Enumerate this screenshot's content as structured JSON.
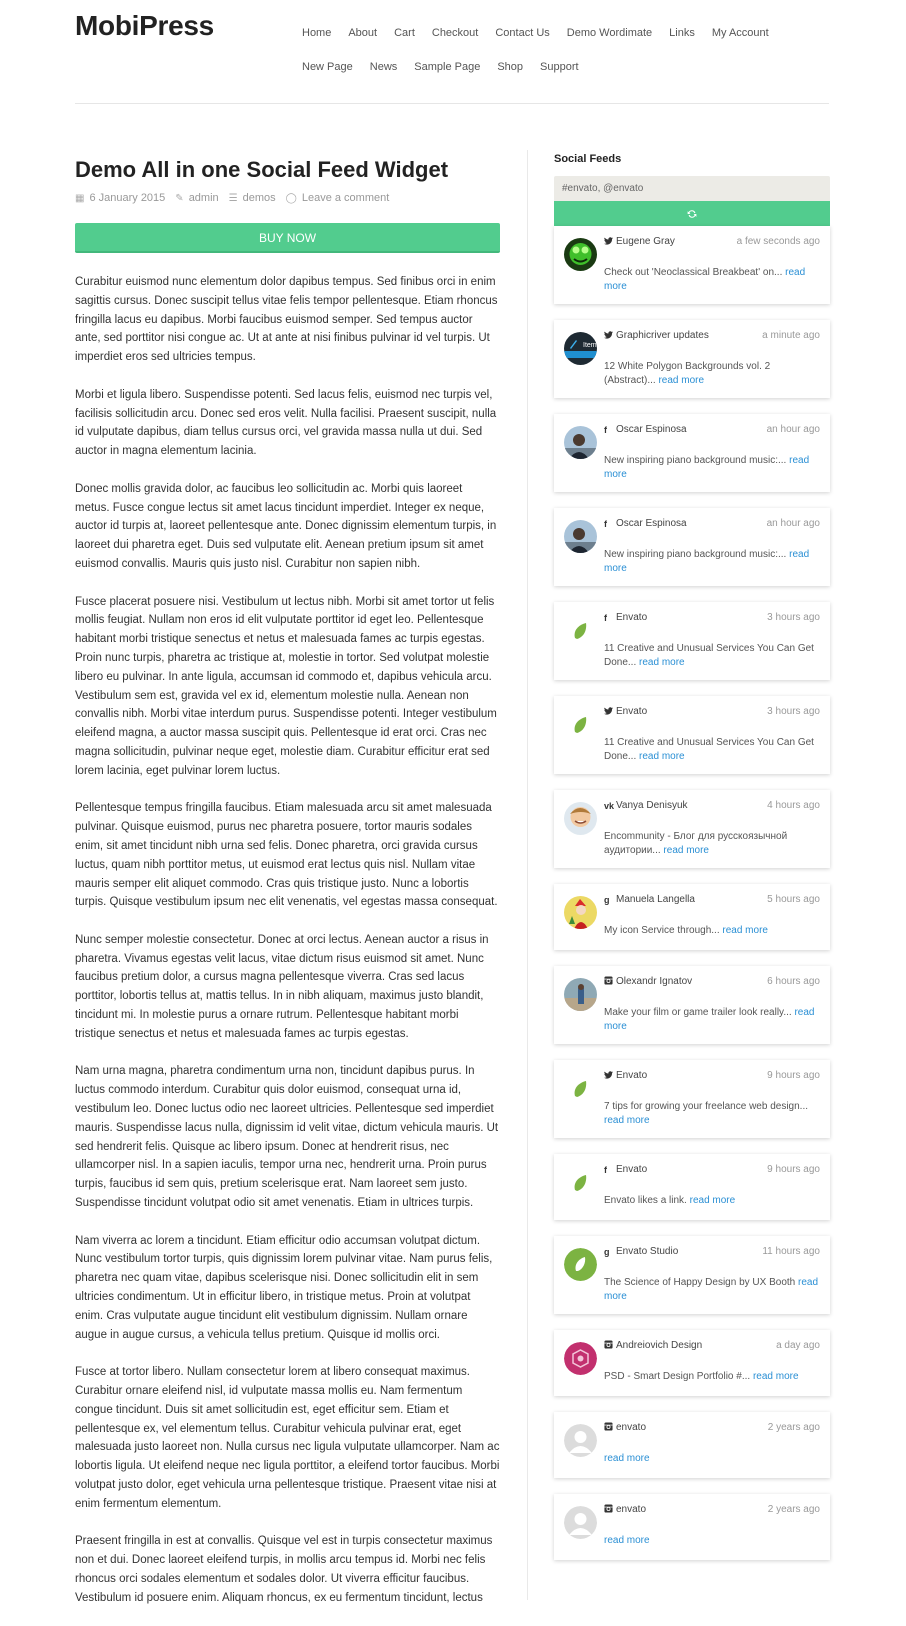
{
  "site": {
    "logo": "MobiPress",
    "nav": [
      "Home",
      "About",
      "Cart",
      "Checkout",
      "Contact Us",
      "Demo Wordimate",
      "Links",
      "My Account",
      "New Page",
      "News",
      "Sample Page",
      "Shop",
      "Support"
    ]
  },
  "post": {
    "title": "Demo All in one Social Feed Widget",
    "date": "6 January 2015",
    "author": "admin",
    "category": "demos",
    "comments": "Leave a comment",
    "buy_label": "BUY NOW",
    "paragraphs": [
      "Curabitur euismod nunc elementum dolor dapibus tempus. Sed finibus orci in enim sagittis cursus. Donec suscipit tellus vitae felis tempor pellentesque. Etiam rhoncus fringilla lacus eu dapibus. Morbi faucibus euismod semper. Sed tempus auctor ante, sed porttitor nisi congue ac. Ut at ante at nisi finibus pulvinar id vel turpis. Ut imperdiet eros sed ultricies tempus.",
      "Morbi et ligula libero. Suspendisse potenti. Sed lacus felis, euismod nec turpis vel, facilisis sollicitudin arcu. Donec sed eros velit. Nulla facilisi. Praesent suscipit, nulla id vulputate dapibus, diam tellus cursus orci, vel gravida massa nulla ut dui. Sed auctor in magna elementum lacinia.",
      "Donec mollis gravida dolor, ac faucibus leo sollicitudin ac. Morbi quis laoreet metus. Fusce congue lectus sit amet lacus tincidunt imperdiet. Integer ex neque, auctor id turpis at, laoreet pellentesque ante. Donec dignissim elementum turpis, in laoreet dui pharetra eget. Duis sed vulputate elit. Aenean pretium ipsum sit amet euismod convallis. Mauris quis justo nisl. Curabitur non sapien nibh.",
      "Fusce placerat posuere nisi. Vestibulum ut lectus nibh. Morbi sit amet tortor ut felis mollis feugiat. Nullam non eros id elit vulputate porttitor id eget leo. Pellentesque habitant morbi tristique senectus et netus et malesuada fames ac turpis egestas. Proin nunc turpis, pharetra ac tristique at, molestie in tortor. Sed volutpat molestie libero eu pulvinar. In ante ligula, accumsan id commodo et, dapibus vehicula arcu. Vestibulum sem est, gravida vel ex id, elementum molestie nulla. Aenean non convallis nibh. Morbi vitae interdum purus. Suspendisse potenti. Integer vestibulum eleifend magna, a auctor massa suscipit quis. Pellentesque id erat orci. Cras nec magna sollicitudin, pulvinar neque eget, molestie diam. Curabitur efficitur erat sed lorem lacinia, eget pulvinar lorem luctus.",
      "Pellentesque tempus fringilla faucibus. Etiam malesuada arcu sit amet malesuada pulvinar. Quisque euismod, purus nec pharetra posuere, tortor mauris sodales enim, sit amet tincidunt nibh urna sed felis. Donec pharetra, orci gravida cursus luctus, quam nibh porttitor metus, ut euismod erat lectus quis nisl. Nullam vitae mauris semper elit aliquet commodo. Cras quis tristique justo. Nunc a lobortis turpis. Quisque vestibulum ipsum nec elit venenatis, vel egestas massa consequat.",
      "Nunc semper molestie consectetur. Donec at orci lectus. Aenean auctor a risus in pharetra. Vivamus egestas velit lacus, vitae dictum risus euismod sit amet. Nunc faucibus pretium dolor, a cursus magna pellentesque viverra. Cras sed lacus porttitor, lobortis tellus at, mattis tellus. In in nibh aliquam, maximus justo blandit, tincidunt mi. In molestie purus a ornare rutrum. Pellentesque habitant morbi tristique senectus et netus et malesuada fames ac turpis egestas.",
      "Nam urna magna, pharetra condimentum urna non, tincidunt dapibus purus. In luctus commodo interdum. Curabitur quis dolor euismod, consequat urna id, vestibulum leo. Donec luctus odio nec laoreet ultricies. Pellentesque sed imperdiet mauris. Suspendisse lacus nulla, dignissim id velit vitae, dictum vehicula mauris. Ut sed hendrerit felis. Quisque ac libero ipsum. Donec at hendrerit risus, nec ullamcorper nisl. In a sapien iaculis, tempor urna nec, hendrerit urna. Proin purus turpis, faucibus id sem quis, pretium scelerisque erat. Nam laoreet sem justo. Suspendisse tincidunt volutpat odio sit amet venenatis. Etiam in ultrices turpis.",
      "Nam viverra ac lorem a tincidunt. Etiam efficitur odio accumsan volutpat dictum. Nunc vestibulum tortor turpis, quis dignissim lorem pulvinar vitae. Nam purus felis, pharetra nec quam vitae, dapibus scelerisque nisi. Donec sollicitudin elit in sem ultricies condimentum. Ut in efficitur libero, in tristique metus. Proin at volutpat enim. Cras vulputate augue tincidunt elit vestibulum dignissim. Nullam ornare augue in augue cursus, a vehicula tellus pretium. Quisque id mollis orci.",
      "Fusce at tortor libero. Nullam consectetur lorem at libero consequat maximus. Curabitur ornare eleifend nisl, id vulputate massa mollis eu. Nam fermentum congue tincidunt. Duis sit amet sollicitudin est, eget efficitur sem. Etiam et pellentesque ex, vel elementum tellus. Curabitur vehicula pulvinar erat, eget malesuada justo laoreet non. Nulla cursus nec ligula vulputate ullamcorper. Nam ac lobortis ligula. Ut eleifend neque nec ligula porttitor, a eleifend tortor faucibus. Morbi volutpat justo dolor, eget vehicula urna pellentesque tristique. Praesent vitae nisi at enim fermentum elementum.",
      "Praesent fringilla in est at convallis. Quisque vel est in turpis consectetur maximus non et dui. Donec laoreet eleifend turpis, in mollis arcu tempus id. Morbi nec felis rhoncus orci sodales elementum et sodales dolor. Ut viverra efficitur faucibus. Vestibulum id posuere enim. Aliquam rhoncus, ex eu fermentum tincidunt, lectus"
    ]
  },
  "sidebar": {
    "title": "Social Feeds",
    "query": "#envato, @envato",
    "refresh_icon": "refresh-icon",
    "read_more": "read more",
    "feeds": [
      {
        "network": "twitter",
        "author": "Eugene Gray",
        "time": "a few seconds ago",
        "text": "Check out 'Neoclassical Breakbeat' on...",
        "avatar": "green-monkey"
      },
      {
        "network": "twitter",
        "author": "Graphicriver updates",
        "time": "a minute ago",
        "text": "12 White Polygon Backgrounds vol. 2 (Abstract)...",
        "avatar": "items-badge"
      },
      {
        "network": "facebook",
        "author": "Oscar Espinosa",
        "time": "an hour ago",
        "text": "New inspiring piano background music:...",
        "avatar": "photo-man"
      },
      {
        "network": "facebook",
        "author": "Oscar Espinosa",
        "time": "an hour ago",
        "text": "New inspiring piano background music:...",
        "avatar": "photo-man"
      },
      {
        "network": "facebook",
        "author": "Envato",
        "time": "3 hours ago",
        "text": "11 Creative and Unusual Services You Can Get Done...",
        "avatar": "envato-leaf"
      },
      {
        "network": "twitter",
        "author": "Envato",
        "time": "3 hours ago",
        "text": "11 Creative and Unusual Services You Can Get Done...",
        "avatar": "envato-leaf"
      },
      {
        "network": "vk",
        "author": "Vanya Denisyuk",
        "time": "4 hours ago",
        "text": "Encommunity - Блог для русскоязычной аудитории...",
        "avatar": "photo-boy"
      },
      {
        "network": "google-plus",
        "author": "Manuela Langella",
        "time": "5 hours ago",
        "text": "My icon Service through...",
        "avatar": "cartoon-girl"
      },
      {
        "network": "instagram",
        "author": "Olexandr Ignatov",
        "time": "6 hours ago",
        "text": "Make your film or game trailer look really...",
        "avatar": "photo-outdoor"
      },
      {
        "network": "twitter",
        "author": "Envato",
        "time": "9 hours ago",
        "text": "7 tips for growing your freelance web design...",
        "avatar": "envato-leaf"
      },
      {
        "network": "facebook",
        "author": "Envato",
        "time": "9 hours ago",
        "text": "Envato likes a link.",
        "avatar": "envato-leaf"
      },
      {
        "network": "google-plus",
        "author": "Envato Studio",
        "time": "11 hours ago",
        "text": "The Science of Happy Design by UX Booth",
        "avatar": "envato-studio"
      },
      {
        "network": "instagram",
        "author": "Andreiovich Design",
        "time": "a day ago",
        "text": "PSD - Smart Design Portfolio #...",
        "avatar": "magenta-logo"
      },
      {
        "network": "instagram",
        "author": "envato",
        "time": "2 years ago",
        "text": "",
        "avatar": "default-user"
      },
      {
        "network": "instagram",
        "author": "envato",
        "time": "2 years ago",
        "text": "",
        "avatar": "default-user"
      }
    ]
  },
  "colors": {
    "accent_green": "#52cc8e",
    "link_blue": "#2a8fd4",
    "envato_green": "#7cb342",
    "magenta": "#c2306e"
  }
}
